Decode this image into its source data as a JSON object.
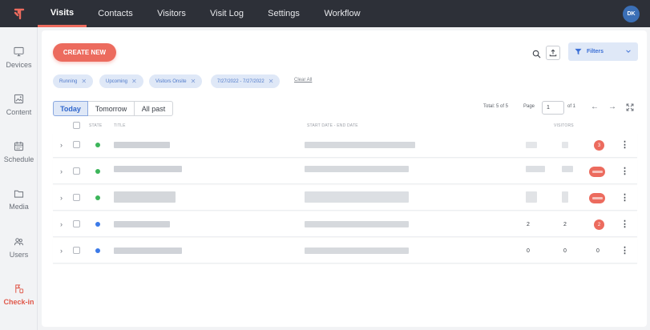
{
  "nav": {
    "tabs": [
      "Visits",
      "Contacts",
      "Visitors",
      "Visit Log",
      "Settings",
      "Workflow"
    ],
    "active_tab": "Visits",
    "avatar_initials": "DK",
    "brand_color": "#ec6b5e"
  },
  "sidebar": {
    "items": [
      {
        "label": "Devices",
        "icon": "monitor-icon"
      },
      {
        "label": "Content",
        "icon": "image-icon"
      },
      {
        "label": "Schedule",
        "icon": "calendar-icon"
      },
      {
        "label": "Media",
        "icon": "folder-icon"
      },
      {
        "label": "Users",
        "icon": "users-icon"
      },
      {
        "label": "Check-in",
        "icon": "check-in-icon"
      }
    ],
    "active_item": "Check-in"
  },
  "toolbar": {
    "create_label": "CREATE NEW",
    "filters_label": "Filters"
  },
  "chips": [
    {
      "label": "Running"
    },
    {
      "label": "Upcoming"
    },
    {
      "label": "Visitors Onsite"
    },
    {
      "label": "7/27/2022 - 7/27/2022"
    }
  ],
  "clear_all_label": "Clear All",
  "range_tabs": [
    "Today",
    "Tomorrow",
    "All past"
  ],
  "active_range": "Today",
  "pagination": {
    "total_label": "Total: 5 of 5",
    "page_label": "Page",
    "page_value": "1",
    "of_label": "of 1"
  },
  "columns": {
    "state": "STATE",
    "title": "TITLE",
    "dates": "START DATE - END DATE",
    "visitors": "VISITORS"
  },
  "rows": [
    {
      "state_color": "#3cb55a",
      "col_a": "",
      "col_b": "",
      "badge": "3"
    },
    {
      "state_color": "#3cb55a",
      "col_a": "",
      "col_b": "",
      "badge": ""
    },
    {
      "state_color": "#3cb55a",
      "col_a": "",
      "col_b": "",
      "badge": ""
    },
    {
      "state_color": "#3b7ae8",
      "col_a": "2",
      "col_b": "2",
      "badge": "2"
    },
    {
      "state_color": "#3b7ae8",
      "col_a": "0",
      "col_b": "0",
      "badge_plain": "0"
    }
  ]
}
